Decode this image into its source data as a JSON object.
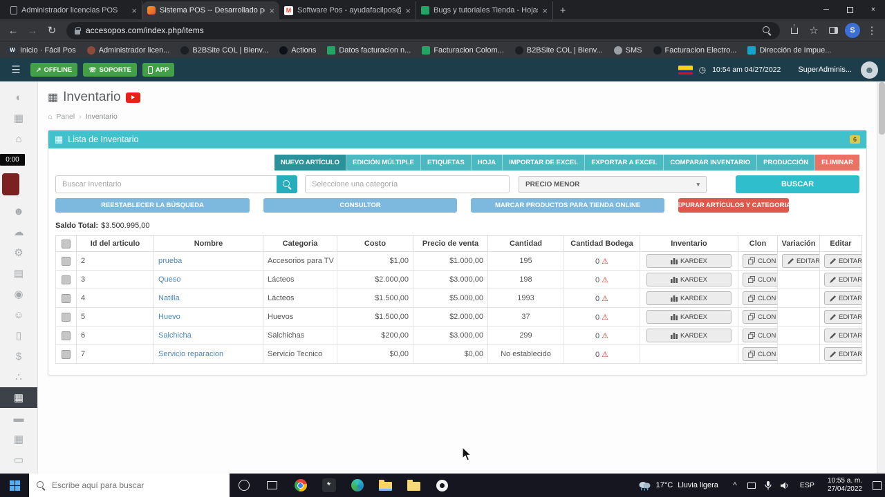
{
  "browser": {
    "tabs": [
      {
        "title": "Administrador licencias POS",
        "icon": "page",
        "active": false
      },
      {
        "title": "Sistema POS -- Desarrollado por",
        "icon": "pos",
        "active": true
      },
      {
        "title": "Software Pos - ayudafacilpos@g",
        "icon": "gmail",
        "active": false
      },
      {
        "title": "Bugs y tutoriales Tienda - Hojas",
        "icon": "sheets",
        "active": false
      }
    ],
    "url": "accesopos.com/index.php/items",
    "profile_initial": "S",
    "bookmarks": [
      {
        "label": "Inicio · Fácil Pos",
        "icon": "wordpress"
      },
      {
        "label": "Administrador licen...",
        "icon": "generic"
      },
      {
        "label": "B2BSite COL | Bienv...",
        "icon": "dark"
      },
      {
        "label": "Actions",
        "icon": "github"
      },
      {
        "label": "Datos facturacion n...",
        "icon": "sheets"
      },
      {
        "label": "Facturacion Colom...",
        "icon": "sheets"
      },
      {
        "label": "B2BSite COL | Bienv...",
        "icon": "dark"
      },
      {
        "label": "SMS",
        "icon": "gray"
      },
      {
        "label": "Facturacion Electro...",
        "icon": "dark"
      },
      {
        "label": "Dirección de Impue...",
        "icon": "teal"
      }
    ]
  },
  "app_header": {
    "offline_label": "OFFLINE",
    "soporte_label": "SOPORTE",
    "app_label": "APP",
    "datetime": "10:54 am 04/27/2022",
    "user": "SuperAdminis..."
  },
  "sidebar": {
    "timer": "0:00",
    "items": [
      "dashboard",
      "calendar",
      "bank",
      "timer",
      "pos-tile",
      "users",
      "cloud",
      "settings",
      "spreadsheet",
      "wheel",
      "person",
      "document",
      "dollar",
      "share",
      "inventory-active",
      "briefcase",
      "calendar-alt",
      "cash"
    ]
  },
  "page": {
    "title": "Inventario",
    "breadcrumb_home": "Panel",
    "breadcrumb_current": "Inventario",
    "card_title": "Lista de Inventario",
    "card_badge": "6",
    "toolbar_buttons": [
      {
        "label": "NUEVO ARTÍCULO",
        "name": "nuevo-articulo",
        "style": "dark"
      },
      {
        "label": "EDICIÓN MÚLTIPLE",
        "name": "edicion-multiple",
        "style": "teal"
      },
      {
        "label": "ETIQUETAS",
        "name": "etiquetas",
        "style": "teal"
      },
      {
        "label": "HOJA",
        "name": "hoja",
        "style": "teal"
      },
      {
        "label": "IMPORTAR DE EXCEL",
        "name": "importar-de-excel",
        "style": "teal"
      },
      {
        "label": "EXPORTAR A EXCEL",
        "name": "exportar-a-excel",
        "style": "teal"
      },
      {
        "label": "COMPARAR INVENTARIO",
        "name": "comparar-inventario",
        "style": "teal"
      },
      {
        "label": "PRODUCCIÓN",
        "name": "produccion",
        "style": "teal"
      },
      {
        "label": "ELIMINAR",
        "name": "eliminar",
        "style": "red"
      }
    ],
    "search_placeholder": "Buscar Inventario",
    "category_placeholder": "Seleccione una categoría",
    "sort_value": "PRECIO MENOR",
    "buscar_label": "BUSCAR",
    "action_buttons": [
      {
        "label": "REESTABLECER LA BÚSQUEDA",
        "name": "reestablecer-busqueda",
        "style": "blue"
      },
      {
        "label": "CONSULTOR",
        "name": "consultor",
        "style": "blue"
      },
      {
        "label": "MARCAR PRODUCTOS PARA TIENDA ONLINE",
        "name": "marcar-productos-tienda-online",
        "style": "blue"
      },
      {
        "label": "DEPURAR ARTÍCULOS Y CATEGORIAS",
        "name": "depurar-articulos-categorias",
        "style": "red"
      }
    ],
    "saldo_label": "Saldo Total:",
    "saldo_value": "$3.500.995,00"
  },
  "inventory": {
    "headers": [
      "Id del articulo",
      "Nombre",
      "Categoria",
      "Costo",
      "Precio de venta",
      "Cantidad",
      "Cantidad Bodega",
      "Inventario",
      "Clon",
      "Variación",
      "Editar"
    ],
    "kardex_label": "KARDEX",
    "clon_label": "CLON",
    "editar_label": "EDITAR",
    "rows": [
      {
        "id": "2",
        "nombre": "prueba",
        "categoria": "Accesorios para TV",
        "costo": "$1,00",
        "precio_venta": "$1.000,00",
        "cantidad": "195",
        "cantidad_bodega": "0",
        "kardex": true,
        "clon": true,
        "variacion_editar": true
      },
      {
        "id": "3",
        "nombre": "Queso",
        "categoria": "Lácteos",
        "costo": "$2.000,00",
        "precio_venta": "$3.000,00",
        "cantidad": "198",
        "cantidad_bodega": "0",
        "kardex": true,
        "clon": true,
        "variacion_editar": false
      },
      {
        "id": "4",
        "nombre": "Natilla",
        "categoria": "Lácteos",
        "costo": "$1.500,00",
        "precio_venta": "$5.000,00",
        "cantidad": "1993",
        "cantidad_bodega": "0",
        "kardex": true,
        "clon": true,
        "variacion_editar": false
      },
      {
        "id": "5",
        "nombre": "Huevo",
        "categoria": "Huevos",
        "costo": "$1.500,00",
        "precio_venta": "$2.000,00",
        "cantidad": "37",
        "cantidad_bodega": "0",
        "kardex": true,
        "clon": true,
        "variacion_editar": false
      },
      {
        "id": "6",
        "nombre": "Salchicha",
        "categoria": "Salchichas",
        "costo": "$200,00",
        "precio_venta": "$3.000,00",
        "cantidad": "299",
        "cantidad_bodega": "0",
        "kardex": true,
        "clon": true,
        "variacion_editar": false
      },
      {
        "id": "7",
        "nombre": "Servicio reparacion",
        "categoria": "Servicio Tecnico",
        "costo": "$0,00",
        "precio_venta": "$0,00",
        "cantidad": "No establecido",
        "cantidad_bodega": "0",
        "kardex": false,
        "clon": true,
        "variacion_editar": false
      }
    ]
  },
  "taskbar": {
    "search_placeholder": "Escribe aquí para buscar",
    "pinned": [
      "cortana",
      "task-view",
      "chrome",
      "photos",
      "edge",
      "file-explorer",
      "folder",
      "clock-app"
    ],
    "weather_temp": "17°C",
    "weather_desc": "Lluvia ligera",
    "language": "ESP",
    "time": "10:55 a. m.",
    "date": "27/04/2022"
  }
}
